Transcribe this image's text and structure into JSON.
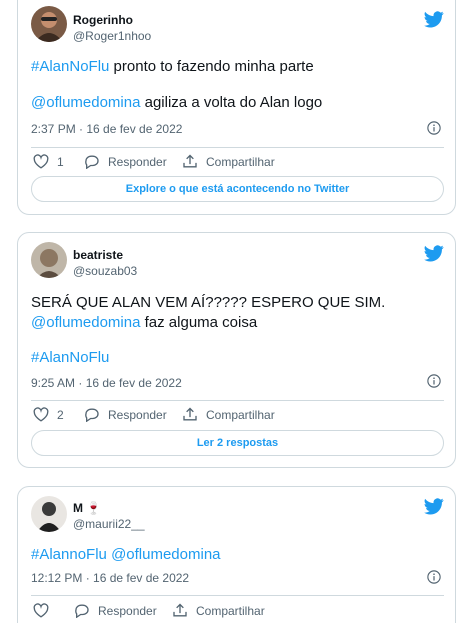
{
  "tweets": [
    {
      "name": "Rogerinho",
      "handle": "@Roger1nhoo",
      "line1_hashtag": "#AlanNoFlu",
      "line1_text": " pronto to fazendo minha parte",
      "line2_mention": "@oflumedomina",
      "line2_text": " agiliza a volta do Alan logo",
      "timestamp": "2:37 PM · 16 de fev de 2022",
      "like_count": "1",
      "reply_label": "Responder",
      "share_label": "Compartilhar",
      "cta_label": "Explore o que está acontecendo no Twitter"
    },
    {
      "name": "beatriste",
      "handle": "@souzab03",
      "line1_text": "SERÁ QUE ALAN VEM AÍ????? ESPERO QUE SIM.",
      "line2_mention": "@oflumedomina",
      "line2_text": " faz alguma coisa",
      "line3_hashtag": "#AlanNoFlu",
      "timestamp": "9:25 AM · 16 de fev de 2022",
      "like_count": "2",
      "reply_label": "Responder",
      "share_label": "Compartilhar",
      "cta_label": "Ler 2 respostas"
    },
    {
      "name": "M 🍷",
      "handle": "@maurii22__",
      "line1_hashtag": "#AlannoFlu",
      "line1_mention": "@oflumedomina",
      "timestamp": "12:12 PM · 16 de fev de 2022",
      "reply_label": "Responder",
      "share_label": "Compartilhar"
    }
  ],
  "colors": {
    "accent": "#1d9bf0",
    "muted": "#536471",
    "border": "#cfd9de"
  },
  "icons": [
    "twitter-bird-icon",
    "heart-icon",
    "reply-icon",
    "share-icon",
    "info-icon"
  ]
}
